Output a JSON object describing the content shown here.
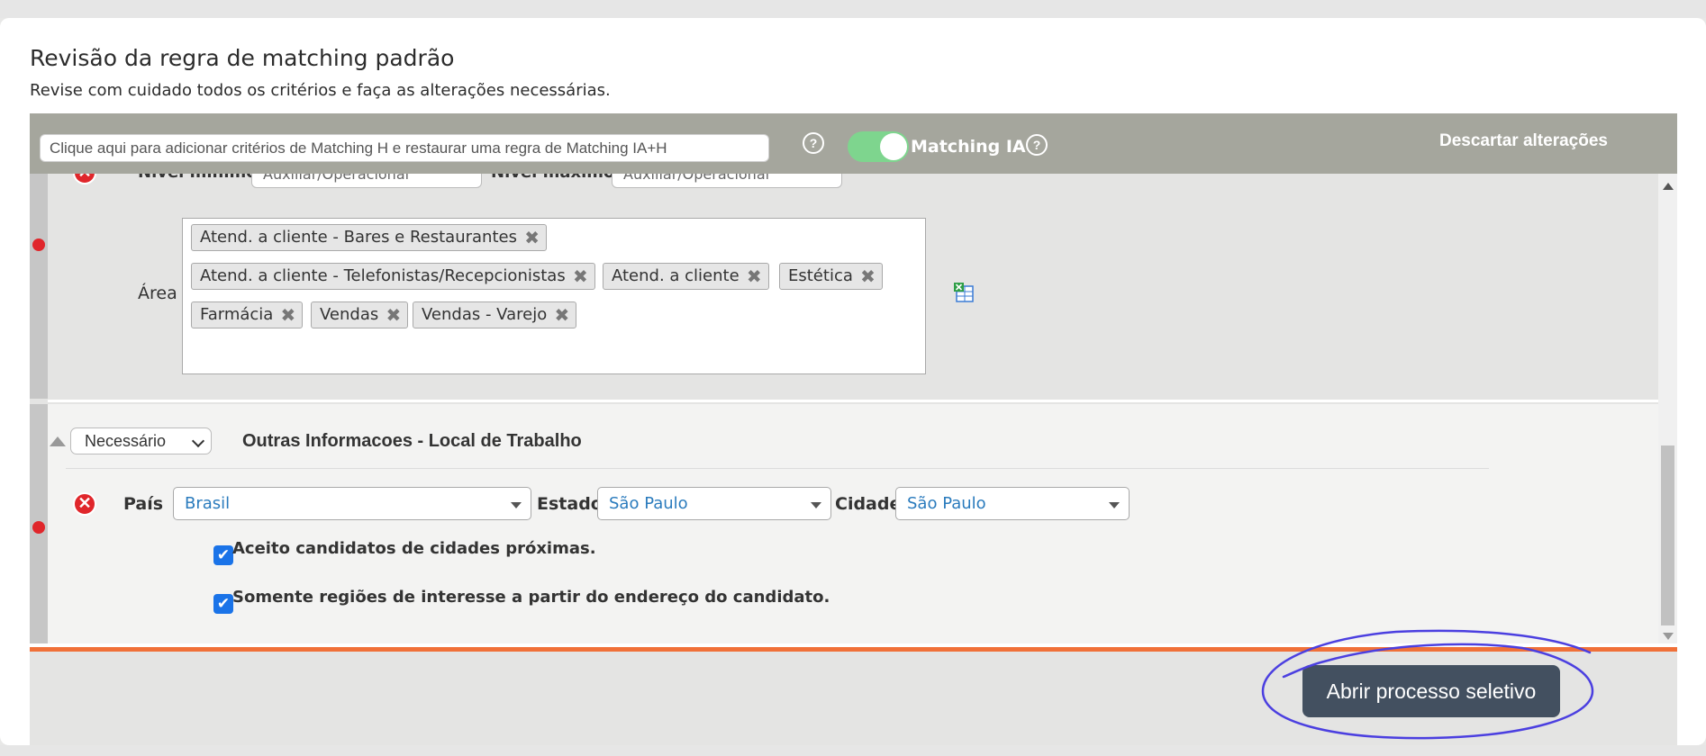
{
  "header": {
    "title": "Revisão da regra de matching padrão",
    "subtitle": "Revise com cuidado todos os critérios e faça as alterações necessárias."
  },
  "toolbar": {
    "search_placeholder": "Clique aqui para adicionar critérios de Matching H e restaurar uma regra de Matching IA+H",
    "help_glyph": "?",
    "toggle_label": "Matching IA",
    "toggle_on": true,
    "discard_label": "Descartar alterações"
  },
  "block_nivel": {
    "min_label": "Nível mínimo",
    "min_value": "Auxiliar/Operacional",
    "max_label": "Nível máximo",
    "max_value": "Auxiliar/Operacional"
  },
  "block_area": {
    "label": "Área",
    "tags": [
      "Atend. a cliente - Bares e Restaurantes",
      "Atend. a cliente - Telefonistas/Recepcionistas",
      "Atend. a cliente",
      "Estética",
      "Farmácia",
      "Vendas",
      "Vendas - Varejo"
    ],
    "tag_remove_glyph": "✖"
  },
  "block_local": {
    "requirement": "Necessário",
    "title": "Outras Informacoes - Local de Trabalho",
    "remove_glyph": "✕",
    "pais_label": "País",
    "pais_value": "Brasil",
    "estado_label": "Estado",
    "estado_value": "São Paulo",
    "cidade_label": "Cidade",
    "cidade_value": "São Paulo",
    "check_glyph": "✔",
    "option1": "Aceito candidatos de cidades próximas.",
    "option1_checked": true,
    "option2": "Somente regiões de interesse a partir do endereço do candidato.",
    "option2_checked": true
  },
  "footer": {
    "open_button": "Abrir processo seletivo"
  },
  "colors": {
    "toolbar_bg": "#a5a69d",
    "toggle_on": "#7ed58e",
    "accent_orange": "#f07038",
    "primary_button": "#435060",
    "link_blue": "#2a7bbd",
    "error_red": "#e0262b",
    "annotation": "#4b3fe0"
  }
}
